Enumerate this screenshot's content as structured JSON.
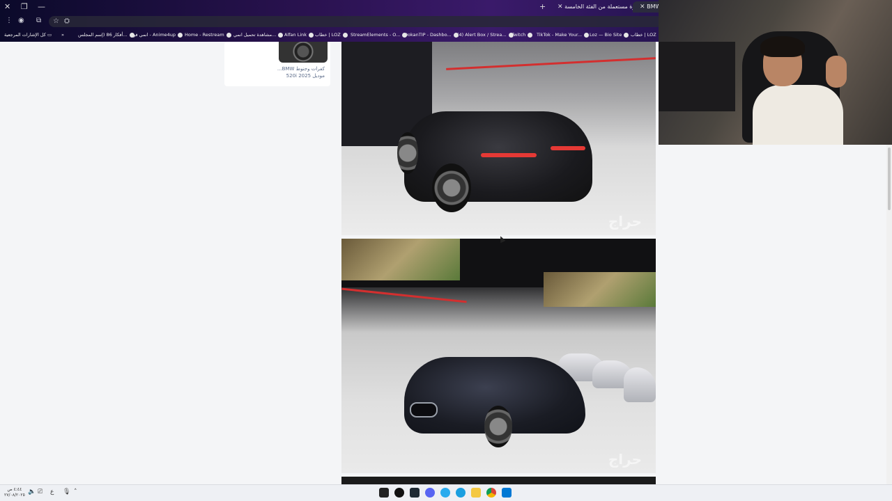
{
  "browser": {
    "tabs": [
      {
        "label": "BMW 52",
        "active": true
      },
      {
        "label": "سيارة مستعملة من الفئة الخامسة",
        "active": false
      }
    ],
    "new_tab_label": "+",
    "bookmarks": [
      "خطاب | LOZ",
      "Loz — Bio Site",
      "TikTok - Make Your...",
      "Twitch",
      "(4) Alert Box / Strea...",
      "DokanTIP - Dashbo...",
      "StreamElements - O...",
      "خطاب | LOZ",
      "Alfan Link",
      "مشاهدة تحميل انمي...",
      "Home - Restream",
      "انمي فور - Anime4up",
      "أفكار 86 (إسم المجلس...",
      "كل الإشارات المرجعية"
    ],
    "overflow_label": "»"
  },
  "listing": {
    "side_card_title": "...BMW كفرات وجنوط",
    "side_card_subtitle": "520i موديل 2025",
    "watermark": "حراج"
  },
  "taskbar": {
    "time": "٤:٤٤ ص",
    "date": "٢٧/٠٨/٢٠٢٥",
    "lang": "ع"
  },
  "colors": {
    "accent_red": "#d32f2f",
    "page_bg": "#f4f5f7",
    "link_text": "#5a6a88"
  }
}
